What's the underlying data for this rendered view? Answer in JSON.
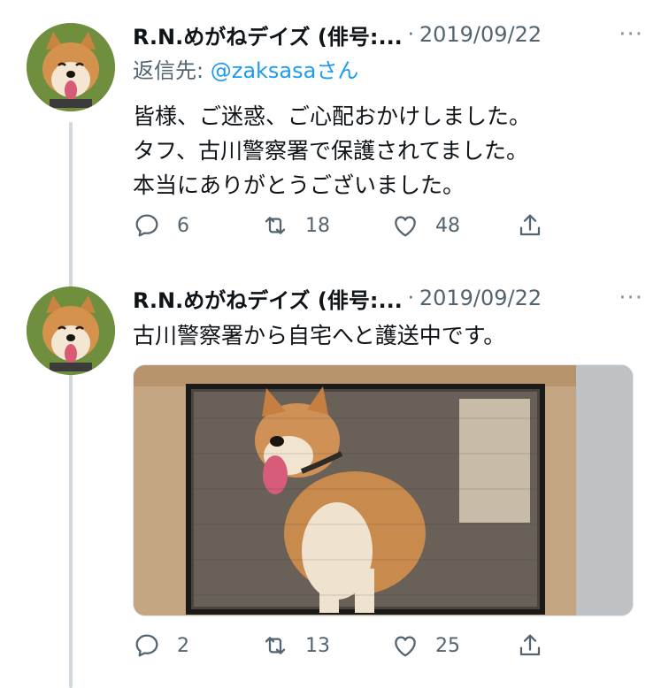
{
  "tweets": [
    {
      "author": "R.N.めがねデイズ (俳号:...",
      "separator": "·",
      "date": "2019/09/22",
      "more": "···",
      "reply_prefix": "返信先: ",
      "reply_handle": "@zaksasa",
      "reply_suffix": "さん",
      "lines": [
        "皆様、ご迷惑、ご心配おかけしました。",
        "タフ、古川警察署で保護されてました。",
        "本当にありがとうございました。"
      ],
      "replies": "6",
      "retweets": "18",
      "likes": "48"
    },
    {
      "author": "R.N.めがねデイズ (俳号:...",
      "separator": "·",
      "date": "2019/09/22",
      "more": "···",
      "lines": [
        "古川警察署から自宅へと護送中です。"
      ],
      "replies": "2",
      "retweets": "13",
      "likes": "25"
    }
  ],
  "icons": {
    "reply": "reply-icon",
    "retweet": "retweet-icon",
    "like": "heart-icon",
    "share": "share-icon",
    "avatar": "shiba-dog-avatar"
  },
  "colors": {
    "text": "#0f1419",
    "secondary": "#536471",
    "link": "#1d9bf0",
    "thread_line": "#cfd9de"
  }
}
